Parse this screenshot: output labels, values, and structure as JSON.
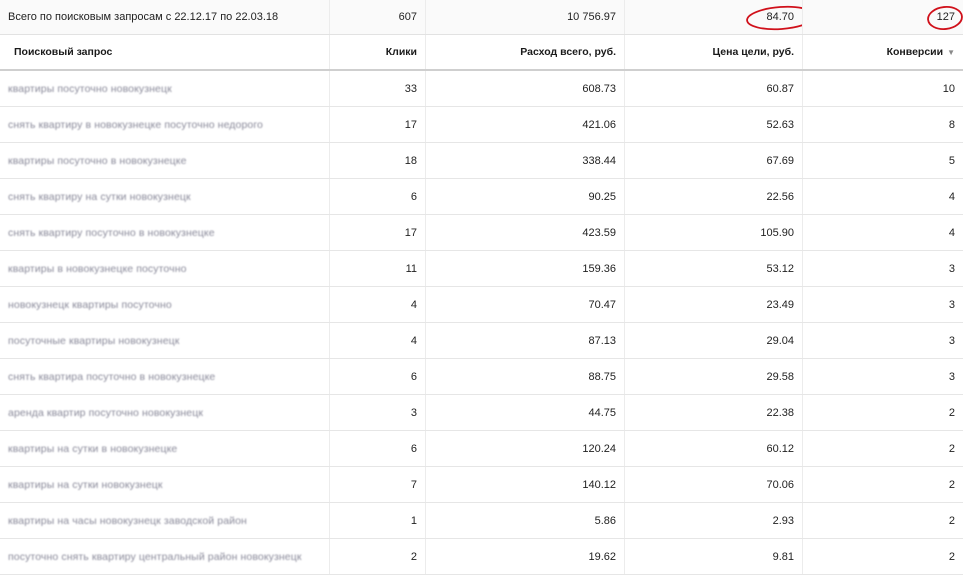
{
  "total": {
    "label": "Всего по поисковым запросам с 22.12.17 по 22.03.18",
    "clicks": "607",
    "spend": "10 756.97",
    "goal_price": "84.70",
    "conversions": "127"
  },
  "columns": {
    "query": "Поисковый запрос",
    "clicks": "Клики",
    "spend": "Расход всего, руб.",
    "goal_price": "Цена цели, руб.",
    "conversions": "Конверсии"
  },
  "sort_icon": "▼",
  "colors": {
    "annotation": "#d0101a"
  },
  "rows": [
    {
      "query": "квартиры посуточно новокузнецк",
      "clicks": "33",
      "spend": "608.73",
      "goal_price": "60.87",
      "conversions": "10"
    },
    {
      "query": "снять квартиру в новокузнецке посуточно недорого",
      "clicks": "17",
      "spend": "421.06",
      "goal_price": "52.63",
      "conversions": "8"
    },
    {
      "query": "квартиры посуточно в новокузнецке",
      "clicks": "18",
      "spend": "338.44",
      "goal_price": "67.69",
      "conversions": "5"
    },
    {
      "query": "снять квартиру на сутки новокузнецк",
      "clicks": "6",
      "spend": "90.25",
      "goal_price": "22.56",
      "conversions": "4"
    },
    {
      "query": "снять квартиру посуточно в новокузнецке",
      "clicks": "17",
      "spend": "423.59",
      "goal_price": "105.90",
      "conversions": "4"
    },
    {
      "query": "квартиры в новокузнецке посуточно",
      "clicks": "11",
      "spend": "159.36",
      "goal_price": "53.12",
      "conversions": "3"
    },
    {
      "query": "новокузнецк квартиры посуточно",
      "clicks": "4",
      "spend": "70.47",
      "goal_price": "23.49",
      "conversions": "3"
    },
    {
      "query": "посуточные квартиры новокузнецк",
      "clicks": "4",
      "spend": "87.13",
      "goal_price": "29.04",
      "conversions": "3"
    },
    {
      "query": "снять квартира посуточно в новокузнецке",
      "clicks": "6",
      "spend": "88.75",
      "goal_price": "29.58",
      "conversions": "3"
    },
    {
      "query": "аренда квартир посуточно новокузнецк",
      "clicks": "3",
      "spend": "44.75",
      "goal_price": "22.38",
      "conversions": "2"
    },
    {
      "query": "квартиры на сутки в новокузнецке",
      "clicks": "6",
      "spend": "120.24",
      "goal_price": "60.12",
      "conversions": "2"
    },
    {
      "query": "квартиры на сутки новокузнецк",
      "clicks": "7",
      "spend": "140.12",
      "goal_price": "70.06",
      "conversions": "2"
    },
    {
      "query": "квартиры на часы новокузнецк заводской район",
      "clicks": "1",
      "spend": "5.86",
      "goal_price": "2.93",
      "conversions": "2"
    },
    {
      "query": "посуточно снять квартиру центральный район новокузнецк",
      "clicks": "2",
      "spend": "19.62",
      "goal_price": "9.81",
      "conversions": "2"
    }
  ]
}
